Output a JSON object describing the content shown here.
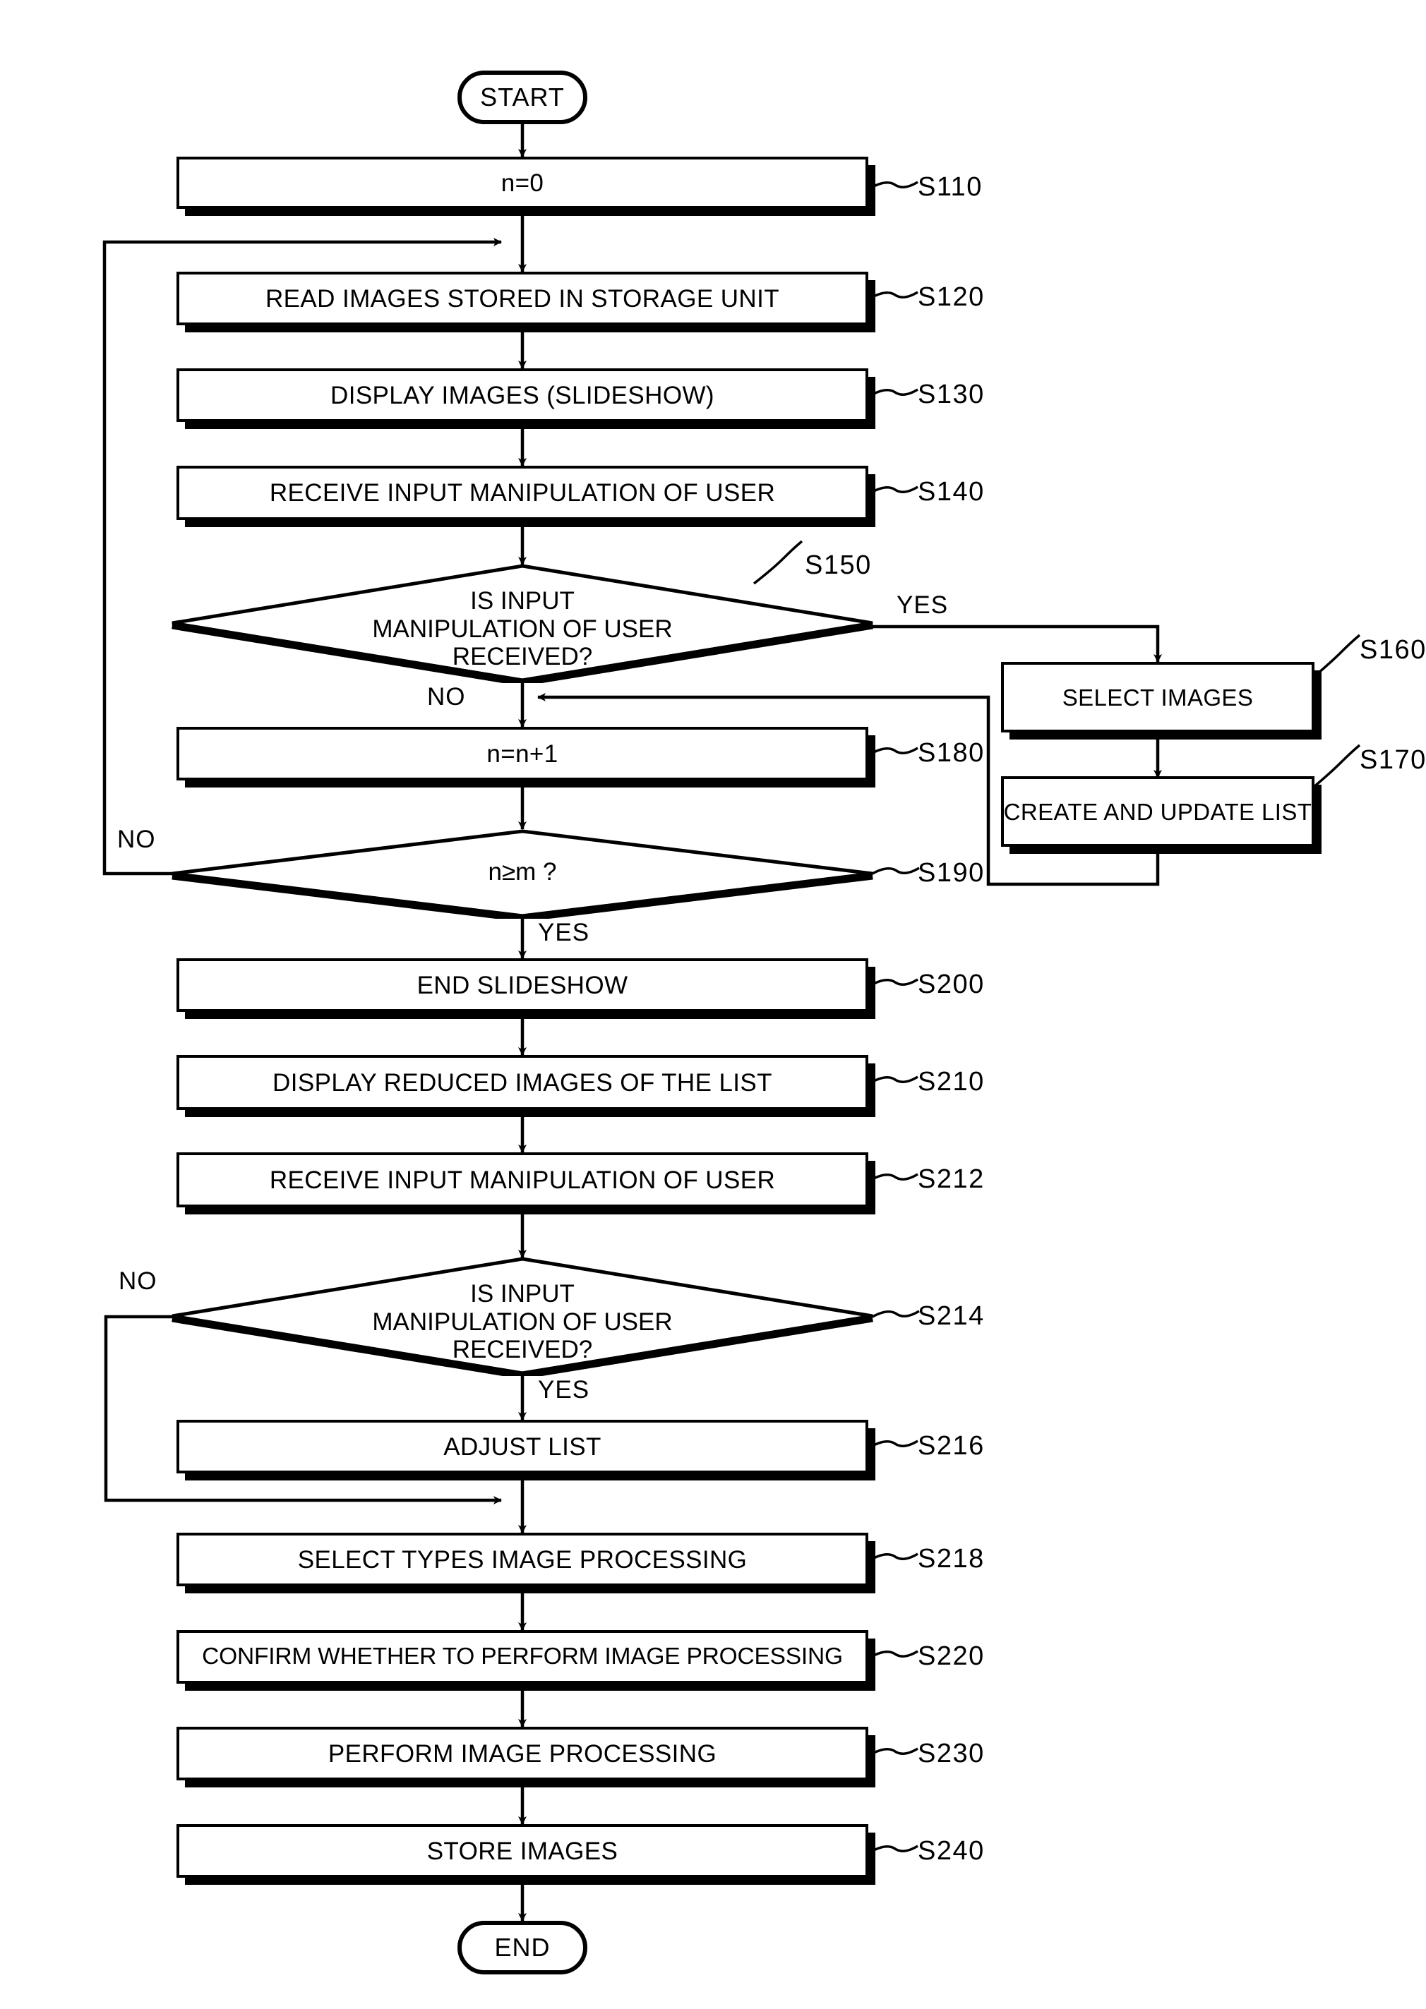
{
  "diagram": {
    "title": "Image processing slideshow flowchart",
    "start_label": "START",
    "end_label": "END",
    "yes_label": "YES",
    "no_label": "NO",
    "stroke_color": "#000000",
    "background_color": "#ffffff"
  },
  "nodes": {
    "start": {
      "text": "START",
      "ref": ""
    },
    "s110": {
      "text": "n=0",
      "ref": "S110"
    },
    "s120": {
      "text": "READ IMAGES STORED IN STORAGE UNIT",
      "ref": "S120"
    },
    "s130": {
      "text": "DISPLAY IMAGES (SLIDESHOW)",
      "ref": "S130"
    },
    "s140": {
      "text": "RECEIVE INPUT MANIPULATION OF USER",
      "ref": "S140"
    },
    "s150": {
      "text": "IS INPUT\nMANIPULATION OF USER\nRECEIVED?",
      "ref": "S150"
    },
    "s160": {
      "text": "SELECT IMAGES",
      "ref": "S160"
    },
    "s170": {
      "text": "CREATE AND UPDATE LIST",
      "ref": "S170"
    },
    "s180": {
      "text": "n=n+1",
      "ref": "S180"
    },
    "s190": {
      "text": "n≥m ?",
      "ref": "S190"
    },
    "s200": {
      "text": "END SLIDESHOW",
      "ref": "S200"
    },
    "s210": {
      "text": "DISPLAY REDUCED IMAGES OF THE LIST",
      "ref": "S210"
    },
    "s212": {
      "text": "RECEIVE INPUT MANIPULATION OF USER",
      "ref": "S212"
    },
    "s214": {
      "text": "IS INPUT\nMANIPULATION OF USER\nRECEIVED?",
      "ref": "S214"
    },
    "s216": {
      "text": "ADJUST LIST",
      "ref": "S216"
    },
    "s218": {
      "text": "SELECT TYPES IMAGE PROCESSING",
      "ref": "S218"
    },
    "s220": {
      "text": "CONFIRM WHETHER TO PERFORM IMAGE PROCESSING",
      "ref": "S220"
    },
    "s230": {
      "text": "PERFORM IMAGE PROCESSING",
      "ref": "S230"
    },
    "s240": {
      "text": "STORE IMAGES",
      "ref": "S240"
    },
    "end": {
      "text": "END",
      "ref": ""
    }
  },
  "branches": {
    "s150_yes": "YES",
    "s150_no": "NO",
    "s190_no": "NO",
    "s190_yes": "YES",
    "s214_no": "NO",
    "s214_yes": "YES"
  }
}
